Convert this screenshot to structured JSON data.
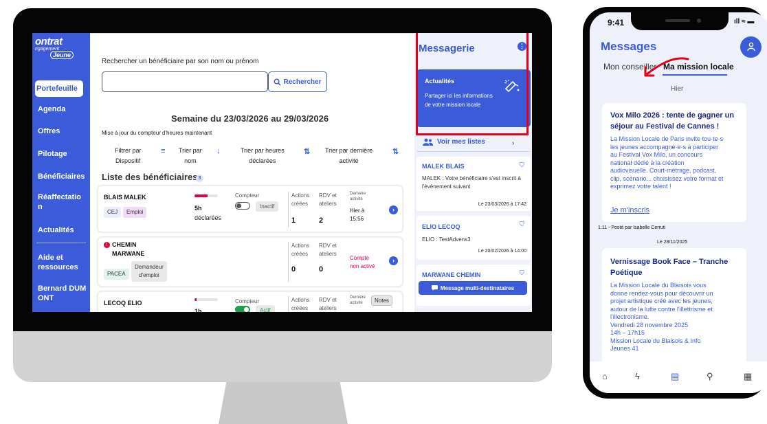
{
  "desktop": {
    "sidebar": {
      "logo": {
        "line1": "ontrat",
        "line2": "ngagement",
        "line3": "Jeune"
      },
      "items": [
        {
          "label": "Portefeuille",
          "active": true
        },
        {
          "label": "Agenda"
        },
        {
          "label": "Offres"
        },
        {
          "label": "Pilotage"
        },
        {
          "label": "Bénéficiaires"
        },
        {
          "label": "Réaffectatio\nn"
        },
        {
          "label": "Actualités"
        },
        {
          "label": "Aide et\nressources"
        },
        {
          "label": "Bernard DUM\nONT"
        }
      ]
    },
    "search": {
      "label": "Rechercher un bénéficiaire par son nom ou prénom",
      "value": "",
      "button_label": "Rechercher",
      "button_icon": "search-icon"
    },
    "week": {
      "title": "Semaine du 23/03/2026 au 29/03/2026",
      "update_note": "Mise à jour du compteur d'heures maintenant"
    },
    "filters": [
      {
        "label": "Filtrer par\nDispositif",
        "icon": "filter-icon"
      },
      {
        "label": "Trier par\nnom",
        "icon": "sort-down-icon"
      },
      {
        "label": "Trier par heures\ndéclarées",
        "icon": "sort-updown-icon"
      },
      {
        "label": "Trier par dernière\nactivité",
        "icon": "sort-updown-icon"
      }
    ],
    "list": {
      "title": "Liste des bénéficiaires",
      "count": "3",
      "rows": [
        {
          "name": "BLAIS MALEK",
          "tags": [
            "CEJ",
            "Emploi"
          ],
          "progress": 0.55,
          "hours_value": "5h",
          "hours_label": "déclarées",
          "counter_label": "Compteur",
          "counter_state": "Inactif",
          "actions_label": "Actions\ncréées",
          "actions": "1",
          "rdv_label": "RDV et\nateliers",
          "rdv": "2",
          "last_label": "Dernière\nactivité",
          "last_value": "Hier à\n15:56"
        },
        {
          "name": "CHEMIN\nMARWANE",
          "alert": "!",
          "tags": [
            "PACEA",
            "Demandeur\nd'emploi"
          ],
          "actions_label": "Actions\ncréées",
          "actions": "0",
          "rdv_label": "RDV et\nateliers",
          "rdv": "0",
          "status": "Compte\nnon activé"
        },
        {
          "name": "LECOQ ELIO",
          "progress": 0.1,
          "hours_value": "1h",
          "counter_label": "Compteur",
          "counter_state": "Actif",
          "actions_label": "Actions\ncréées",
          "rdv_label": "RDV et\nateliers",
          "last_label": "Dernière\nactivité",
          "tooltip": "Notes"
        }
      ]
    },
    "messaging": {
      "title": "Messagerie",
      "menu_icon": "kebab-icon",
      "news_card": {
        "title": "Actualités",
        "text": "Partager ici les informations de votre mission locale",
        "icon": "megaphone-icon"
      },
      "lists_link": "Voir mes listes",
      "conversations": [
        {
          "name": "MALEK BLAIS",
          "message": "MALEK : Votre bénéficiaire s'est inscrit à l'événement suivant",
          "date": "Le 23/03/2026 à 17:42"
        },
        {
          "name": "ELIO LECOQ",
          "message": "ELIO : TestAdvens3",
          "date": "Le 20/02/2026 à 14:00"
        },
        {
          "name": "MARWANE CHEMIN"
        }
      ],
      "multi_button": "Message multi-destinataires",
      "highlight_color": "#e3001b"
    }
  },
  "phone": {
    "time": "9:41",
    "status_icons": "ıll ≈ ▬",
    "title": "Messages",
    "tabs": [
      {
        "label": "Mon conseiller"
      },
      {
        "label": "Ma mission locale",
        "active": true
      }
    ],
    "day_label": "Hier",
    "posts": [
      {
        "title": "Vox Milo 2026 : tente de gagner un séjour au Festival de Cannes !",
        "body": "La Mission Locale de Paris invite tou·te·s\nles jeunes accompagné·e·s à participer\nau Festival Vox Milo, un concours\nnational dédié à la création\naudiovisuelle. Court-métrage, podcast,\nclip, scénario... choisissez votre format et\nexprimez votre talent !",
        "link": "Je m'inscris",
        "meta": "1:11 - Posté par Isabelle Cerruti"
      },
      {
        "date": "Le 28/11/2025",
        "title": "Vernissage Book Face – Tranche Poétique",
        "body": "La Mission Locale du Blaisois vous\ndonne rendez-vous pour découvrir un\nprojet artistique créé avec les jeunes,\nautour de la lutte contre l'illettrisme et\nl'illectronisme.\n Vendredi 28 novembre 2025\n 14h – 17h15\n Mission Locale du Blaisois & Info\nJeunes 41"
      }
    ],
    "nav": [
      {
        "icon": "home-icon",
        "glyph": "⌂"
      },
      {
        "icon": "lightning-icon",
        "glyph": "ϟ"
      },
      {
        "icon": "chat-icon",
        "glyph": "▤",
        "active": true
      },
      {
        "icon": "search-icon",
        "glyph": "⚲"
      },
      {
        "icon": "calendar-icon",
        "glyph": "▦"
      }
    ],
    "accent": "#3b5bdb"
  }
}
